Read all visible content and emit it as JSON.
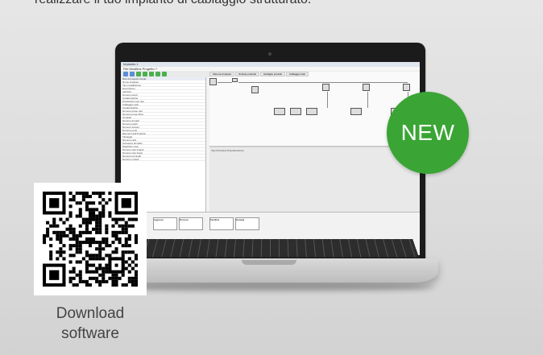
{
  "header": {
    "text": "realizzare il tuo impianto di cablaggio strutturato."
  },
  "software": {
    "title": "Impianto 1",
    "menu": "File  Modifica  Progetto  ?",
    "tabs": [
      "Schema impianto",
      "Schede prodotto",
      "Dettaglio prodotti",
      "Cablaggio rack"
    ],
    "left_header": "Dati di progetto   Guida",
    "left_rows": [
      "Nome impianto",
      "Tipo installazione",
      "Descrizione",
      "Indirizzo",
      "Numero utenti",
      "Caratteristiche",
      "Prestazioni cavi rete",
      "Cablaggio rack",
      "Caratteristiche",
      "Numero prese rete",
      "Numero prese fibra",
      "Armadio",
      "Numero armadi",
      "Numero patch",
      "Numero sezioni",
      "Numero ponti",
      "Elementi dell'impianto",
      "Tipologia",
      "Numero rack",
      "Accessori armadio",
      "Ripartitori cavo",
      "Numero cavi singoli",
      "Numero cavi doppi",
      "Numero terminali",
      "Numero moduli"
    ],
    "lower_panel": "Tipo  Proprieta  Proprieta  Errore",
    "bottom_buttons": [
      "Aggiungi",
      "Rimuovi",
      "Modifica",
      "Dettagli"
    ]
  },
  "badge": {
    "label": "NEW",
    "color": "#3aa535"
  },
  "qr": {
    "caption_line1": "Download",
    "caption_line2": "software"
  }
}
